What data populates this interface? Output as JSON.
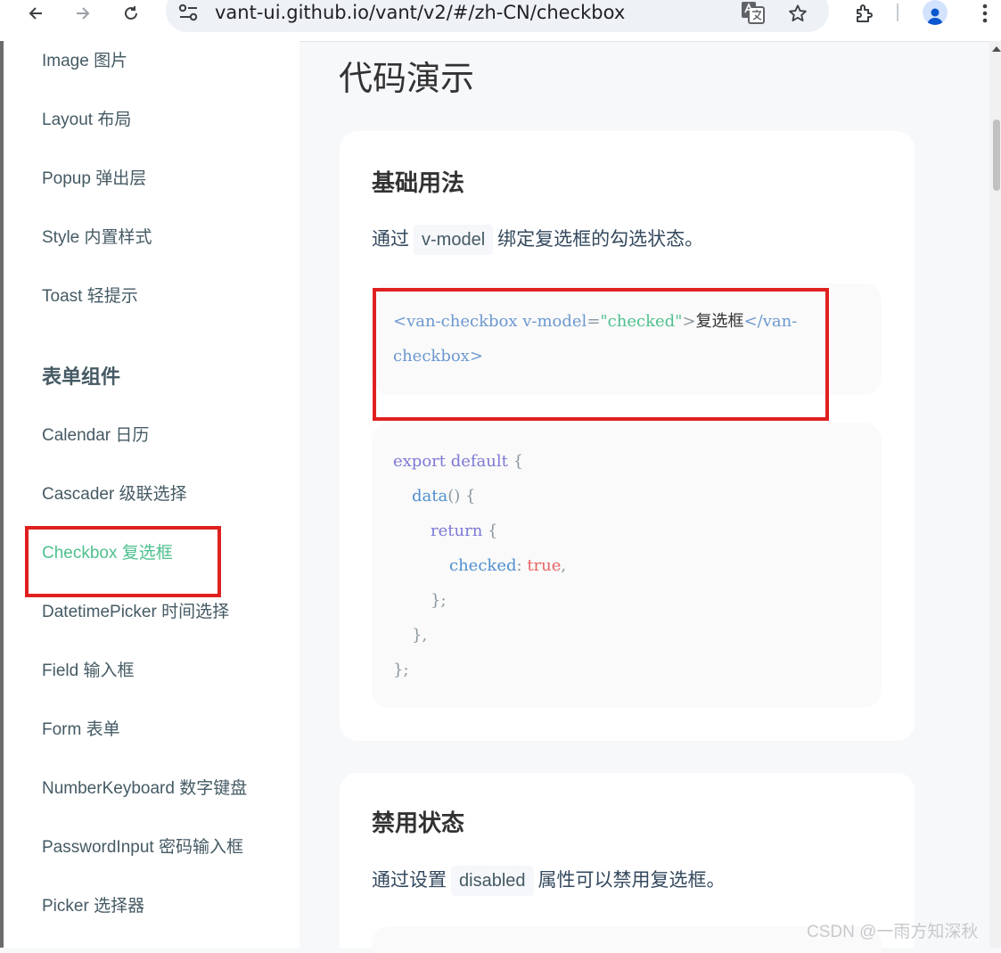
{
  "browser": {
    "url": "vant-ui.github.io/vant/v2/#/zh-CN/checkbox"
  },
  "sidebar": {
    "items_top": [
      {
        "label": "Image 图片"
      },
      {
        "label": "Layout 布局"
      },
      {
        "label": "Popup 弹出层"
      },
      {
        "label": "Style 内置样式"
      },
      {
        "label": "Toast 轻提示"
      }
    ],
    "group_title": "表单组件",
    "items_form": [
      {
        "label": "Calendar 日历"
      },
      {
        "label": "Cascader 级联选择"
      },
      {
        "label": "Checkbox 复选框",
        "active": true
      },
      {
        "label": "DatetimePicker 时间选择"
      },
      {
        "label": "Field 输入框"
      },
      {
        "label": "Form 表单"
      },
      {
        "label": "NumberKeyboard 数字键盘"
      },
      {
        "label": "PasswordInput 密码输入框"
      },
      {
        "label": "Picker 选择器"
      }
    ]
  },
  "content": {
    "page_title": "代码演示",
    "basic": {
      "title": "基础用法",
      "desc_before": "通过",
      "desc_code": "v-model",
      "desc_after": "绑定复选框的勾选状态。",
      "template_code": {
        "line1": {
          "open_tag": "<van-checkbox",
          "attr": "v-model",
          "eq": "=",
          "value": "\"checked\"",
          "close": ">",
          "text": "复选框",
          "end_tag": "</van-"
        },
        "line2": {
          "end_tag": "checkbox>"
        }
      },
      "script_code": {
        "l1_kw": "export default",
        "l1_brace": "{",
        "l2_fn": "data",
        "l2_rest": "() {",
        "l3_kw": "return",
        "l3_brace": "{",
        "l4_key": "checked",
        "l4_colon": ":",
        "l4_val": "true",
        "l4_comma": ",",
        "l5": "};",
        "l6": "},",
        "l7": "};"
      }
    },
    "disabled": {
      "title": "禁用状态",
      "desc_before": "通过设置",
      "desc_code": "disabled",
      "desc_after": "属性可以禁用复选框。"
    }
  },
  "watermark": "CSDN @一雨方知深秋",
  "colors": {
    "accent": "#4fc08d",
    "highlight_border": "#e02020",
    "text": "#323233",
    "nav_text": "#455a64"
  }
}
